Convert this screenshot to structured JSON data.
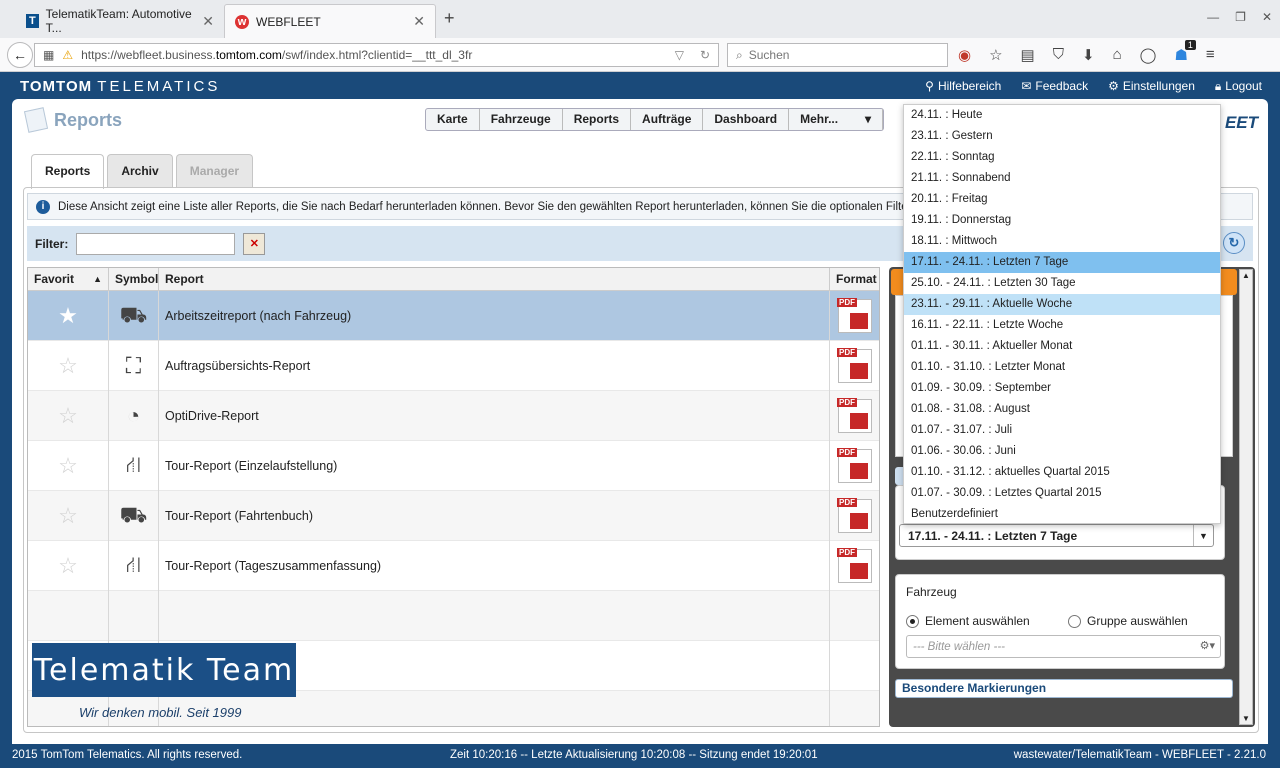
{
  "browser": {
    "tabs": [
      {
        "title": "TelematikTeam: Automotive T...",
        "favicon": "T"
      },
      {
        "title": "WEBFLEET",
        "favicon": "w"
      }
    ],
    "url_prefix": "https://webfleet.business.",
    "url_host": "tomtom.com",
    "url_suffix": "/swf/index.html?clientid=__ttt_dl_3fr",
    "search_placeholder": "Suchen",
    "badge_count": "1"
  },
  "header": {
    "brand_bold": "TOMTOM",
    "brand_light": "TELEMATICS",
    "links": [
      "Hilfebereich",
      "Feedback",
      "Einstellungen",
      "Logout"
    ]
  },
  "page": {
    "title": "Reports",
    "logo": "EET"
  },
  "mainnav": [
    "Karte",
    "Fahrzeuge",
    "Reports",
    "Aufträge",
    "Dashboard",
    "Mehr..."
  ],
  "subtabs": [
    "Reports",
    "Archiv",
    "Manager"
  ],
  "info": "Diese Ansicht zeigt eine Liste aller Reports, die Sie nach Bedarf herunterladen können. Bevor Sie den gewählten Report herunterladen, können Sie die optionalen Filter und beso",
  "filter": {
    "label": "Filter:",
    "value": ""
  },
  "table": {
    "headers": [
      "Favorit",
      "Symbol",
      "Report",
      "Format"
    ],
    "rows": [
      {
        "report": "Arbeitszeitreport (nach Fahrzeug)",
        "icon": "truck-clock-icon",
        "format": "PDF"
      },
      {
        "report": "Auftragsübersichts-Report",
        "icon": "handtruck-icon",
        "format": "PDF"
      },
      {
        "report": "OptiDrive-Report",
        "icon": "gauge-icon",
        "format": "PDF"
      },
      {
        "report": "Tour-Report (Einzelaufstellung)",
        "icon": "road-icon",
        "format": "PDF"
      },
      {
        "report": "Tour-Report (Fahrtenbuch)",
        "icon": "truck-clock-icon",
        "format": "PDF"
      },
      {
        "report": "Tour-Report (Tageszusammenfassung)",
        "icon": "road-24-icon",
        "format": "PDF"
      }
    ]
  },
  "overlay": {
    "logo_text": "Telematik Team",
    "slogan": "Wir denken mobil. Seit 1999"
  },
  "right_panel": {
    "period_value": "17.11. - 24.11. : Letzten 7 Tage",
    "vehicle_label": "Fahrzeug",
    "radio_element": "Element auswählen",
    "radio_group": "Gruppe auswählen",
    "vehicle_placeholder": "--- Bitte wählen ---",
    "special_label": "Besondere Markierungen"
  },
  "dropdown": {
    "items": [
      "24.11. : Heute",
      "23.11. : Gestern",
      "22.11. : Sonntag",
      "21.11. : Sonnabend",
      "20.11. : Freitag",
      "19.11. : Donnerstag",
      "18.11. : Mittwoch",
      "17.11. - 24.11. : Letzten 7 Tage",
      "25.10. - 24.11. : Letzten 30 Tage",
      "23.11. - 29.11. : Aktuelle Woche",
      "16.11. - 22.11. : Letzte Woche",
      "01.11. - 30.11. : Aktueller Monat",
      "01.10. - 31.10. : Letzter Monat",
      "01.09. - 30.09. : September",
      "01.08. - 31.08. : August",
      "01.07. - 31.07. : Juli",
      "01.06. - 30.06. : Juni",
      "01.10. - 31.12. : aktuelles Quartal 2015",
      "01.07. - 30.09. : Letztes Quartal 2015",
      "Benutzerdefiniert"
    ],
    "hover_index": 7,
    "selected_index": 9
  },
  "footer": {
    "left": "2015 TomTom Telematics. All rights reserved.",
    "center": "Zeit 10:20:16  -- Letzte Aktualisierung 10:20:08  -- Sitzung endet 19:20:01",
    "right": "wastewater/TelematikTeam - WEBFLEET - 2.21.0"
  }
}
